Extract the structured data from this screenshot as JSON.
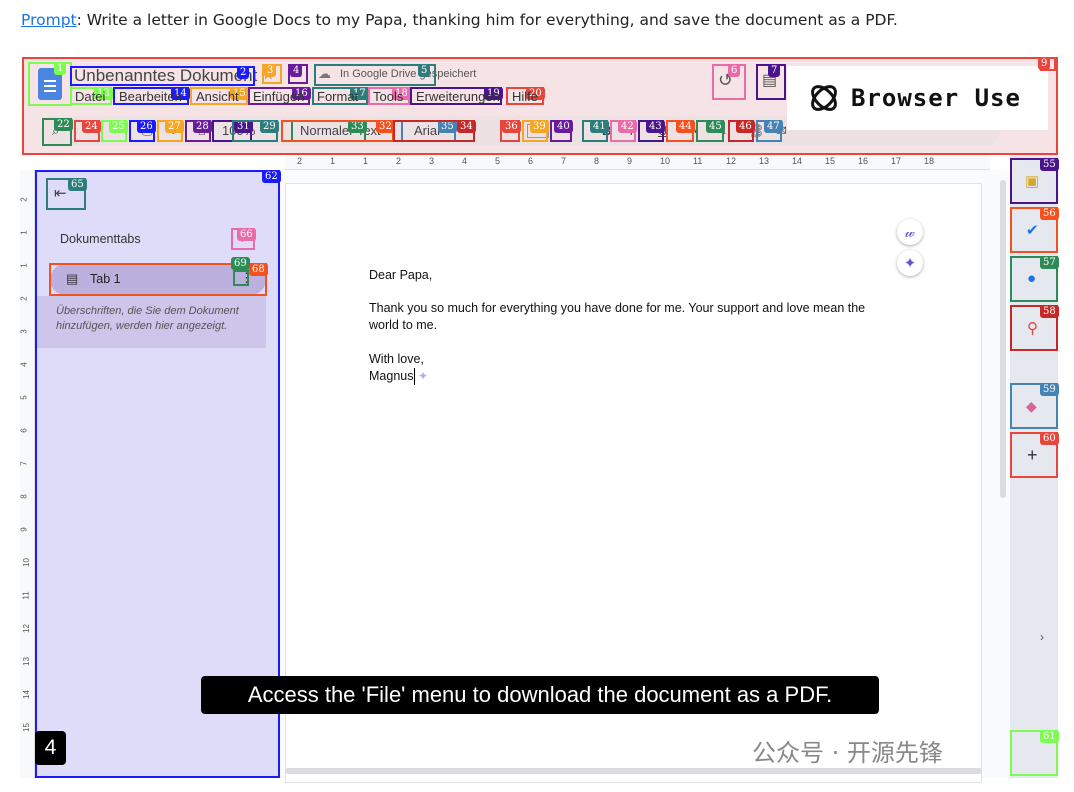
{
  "prompt": {
    "link": "Prompt",
    "text": ": Write a letter in Google Docs to my Papa, thanking him for everything, and save the document as a PDF."
  },
  "docs": {
    "title": "Unbenanntes Dokument",
    "saved": "In Google Drive gespeichert",
    "menus": [
      "Datei",
      "Bearbeiten",
      "Ansicht",
      "Einfügen",
      "Format",
      "Tools",
      "Erweiterungen",
      "Hilfe"
    ],
    "zoom": "100%",
    "style": "Normaler Text",
    "font": "Arial"
  },
  "logo": {
    "text": "Browser Use"
  },
  "sidebar": {
    "heading": "Dokumenttabs",
    "tab": "Tab 1",
    "hint": "Überschriften, die Sie dem Dokument hinzufügen, werden hier angezeigt."
  },
  "document": {
    "greeting": "Dear Papa,",
    "body": "Thank you so much for everything you have done for me. Your support and love mean the world to me.",
    "closing": "With love,",
    "signature": "Magnus"
  },
  "ruler_top": [
    "2",
    "1",
    "1",
    "2",
    "3",
    "4",
    "5",
    "6",
    "7",
    "8",
    "9",
    "10",
    "11",
    "12",
    "13",
    "14",
    "15",
    "16",
    "17",
    "18"
  ],
  "ruler_left": [
    "2",
    "1",
    "1",
    "2",
    "3",
    "4",
    "5",
    "6",
    "7",
    "8",
    "9",
    "10",
    "11",
    "12",
    "13",
    "14",
    "15"
  ],
  "caption": "Access the 'File' menu to download the document as a PDF.",
  "step": "4",
  "watermark": "公众号 · 开源先锋",
  "overlay_labels": [
    "1",
    "2",
    "3",
    "4",
    "5",
    "6",
    "7",
    "9",
    "13",
    "14",
    "15",
    "16",
    "17",
    "18",
    "19",
    "20",
    "22",
    "24",
    "25",
    "26",
    "27",
    "28",
    "31",
    "29",
    "33",
    "32",
    "35",
    "34",
    "36",
    "39",
    "40",
    "41",
    "42",
    "43",
    "44",
    "45",
    "46",
    "47",
    "55",
    "56",
    "57",
    "58",
    "59",
    "60",
    "61",
    "62",
    "65",
    "66",
    "68",
    "69"
  ]
}
